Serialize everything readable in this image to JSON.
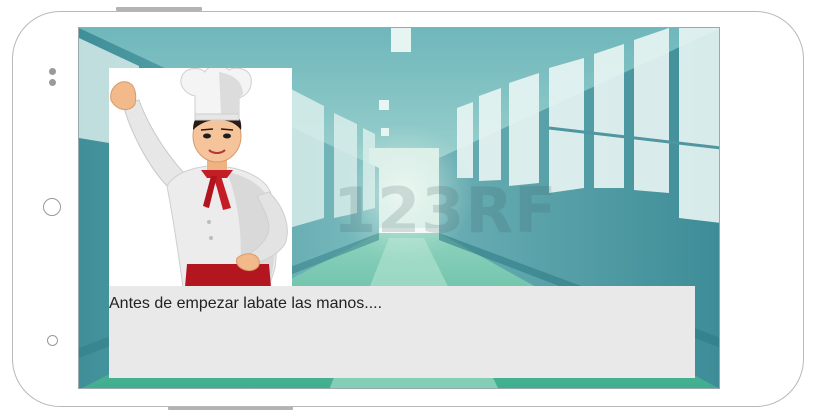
{
  "game": {
    "dialog_text": "Antes de empezar labate las manos....",
    "watermark": "123RF"
  },
  "colors": {
    "dialog_background": "#e9e9e9",
    "phone_frame": "#b8b8b8",
    "corridor_wall": "#4f9aa3",
    "corridor_floor": "#3aa98a"
  },
  "icons": {
    "home": "home-circle-icon",
    "back": "back-circle-icon",
    "camera": "camera-dot-icon"
  }
}
